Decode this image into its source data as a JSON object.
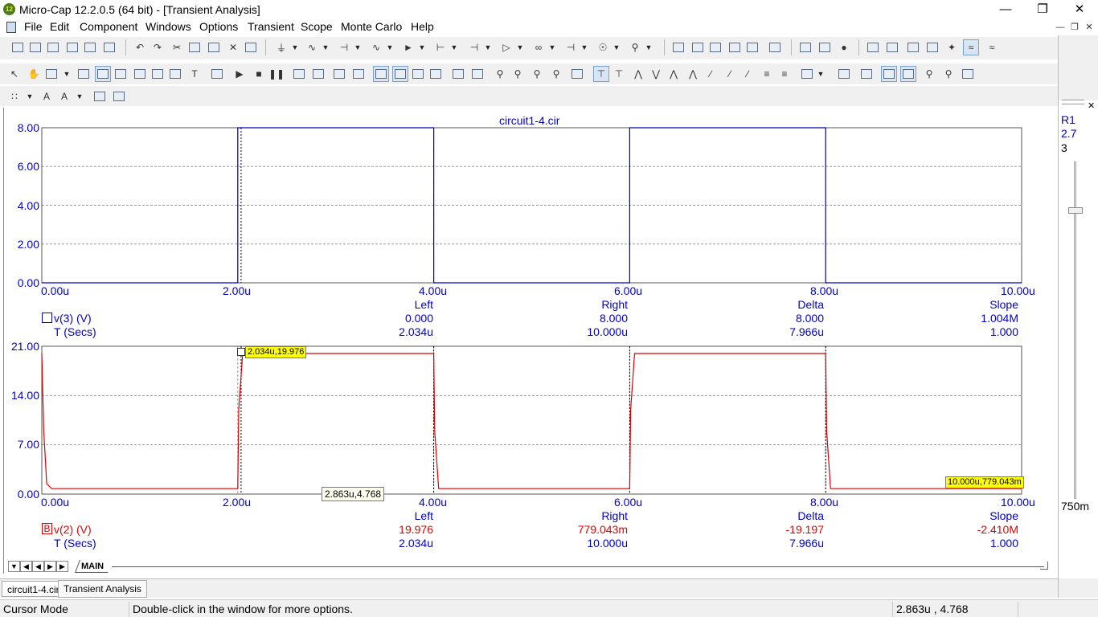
{
  "window": {
    "title": "Micro-Cap 12.2.0.5 (64 bit) - [Transient Analysis]",
    "icon_text": "12"
  },
  "menu": [
    "File",
    "Edit",
    "Component",
    "Windows",
    "Options",
    "Transient",
    "Scope",
    "Monte Carlo",
    "Help"
  ],
  "right_panel": {
    "label1": "R1",
    "label2": "2.7",
    "label3": "3",
    "scale_label": "750m"
  },
  "plot": {
    "title": "circuit1-4.cir",
    "accent_blue": "#0000c8",
    "accent_red": "#e00000",
    "top": {
      "y_ticks": [
        "8.00",
        "6.00",
        "4.00",
        "2.00",
        "0.00"
      ],
      "x_ticks": [
        "0.00u",
        "2.00u",
        "4.00u",
        "6.00u",
        "8.00u",
        "10.00u"
      ],
      "headers": [
        "Left",
        "Right",
        "Delta",
        "Slope"
      ],
      "row1_name": "v(3) (V)",
      "row1": [
        "0.000",
        "8.000",
        "8.000",
        "1.004M"
      ],
      "row2_name": "T (Secs)",
      "row2": [
        "2.034u",
        "10.000u",
        "7.966u",
        "1.000"
      ]
    },
    "bottom": {
      "y_ticks": [
        "21.00",
        "14.00",
        "7.00",
        "0.00"
      ],
      "x_ticks": [
        "0.00u",
        "2.00u",
        "4.00u",
        "6.00u",
        "8.00u",
        "10.00u"
      ],
      "headers": [
        "Left",
        "Right",
        "Delta",
        "Slope"
      ],
      "row1_marker": "B",
      "row1_name": "v(2) (V)",
      "row1": [
        "19.976",
        "779.043m",
        "-19.197",
        "-2.410M"
      ],
      "row2_name": "T (Secs)",
      "row2": [
        "2.034u",
        "10.000u",
        "7.966u",
        "1.000"
      ],
      "cursor_left_label": "2.034u,19.976",
      "cursor_right_label": "10.000u,779.043m",
      "mouse_label": "2.863u,4.768"
    }
  },
  "chart_data": [
    {
      "type": "line",
      "title": "circuit1-4.cir",
      "xlabel": "T (Secs)",
      "ylabel": "v(3) (V)",
      "xlim": [
        0,
        10
      ],
      "ylim": [
        0,
        8
      ],
      "x_unit": "u",
      "grid": true,
      "series": [
        {
          "name": "v(3) (V)",
          "color": "#0000c8",
          "x": [
            0,
            2,
            2,
            4,
            4,
            6,
            6,
            8,
            8,
            10
          ],
          "y": [
            0,
            0,
            8,
            8,
            0,
            0,
            8,
            8,
            0,
            0
          ]
        }
      ]
    },
    {
      "type": "line",
      "xlabel": "T (Secs)",
      "ylabel": "v(2) (V)",
      "xlim": [
        0,
        10
      ],
      "ylim": [
        0,
        21
      ],
      "x_unit": "u",
      "grid": true,
      "series": [
        {
          "name": "v(2) (V)",
          "color": "#e00000",
          "x": [
            0,
            0.02,
            0.05,
            0.1,
            2,
            2.01,
            2.05,
            4,
            4.01,
            4.05,
            6,
            6.01,
            6.05,
            8,
            8.01,
            8.05,
            10
          ],
          "y": [
            20,
            9,
            1.5,
            0.78,
            0.78,
            12,
            19.976,
            19.976,
            9,
            0.78,
            0.78,
            12,
            19.976,
            19.976,
            9,
            0.78,
            0.779
          ]
        }
      ]
    }
  ],
  "tabs": {
    "sheet": "MAIN",
    "doc1": "circuit1-4.cir",
    "doc2": "Transient Analysis"
  },
  "status": {
    "mode": "Cursor Mode",
    "hint": "Double-click in the window for more options.",
    "coords": "2.863u , 4.768"
  }
}
